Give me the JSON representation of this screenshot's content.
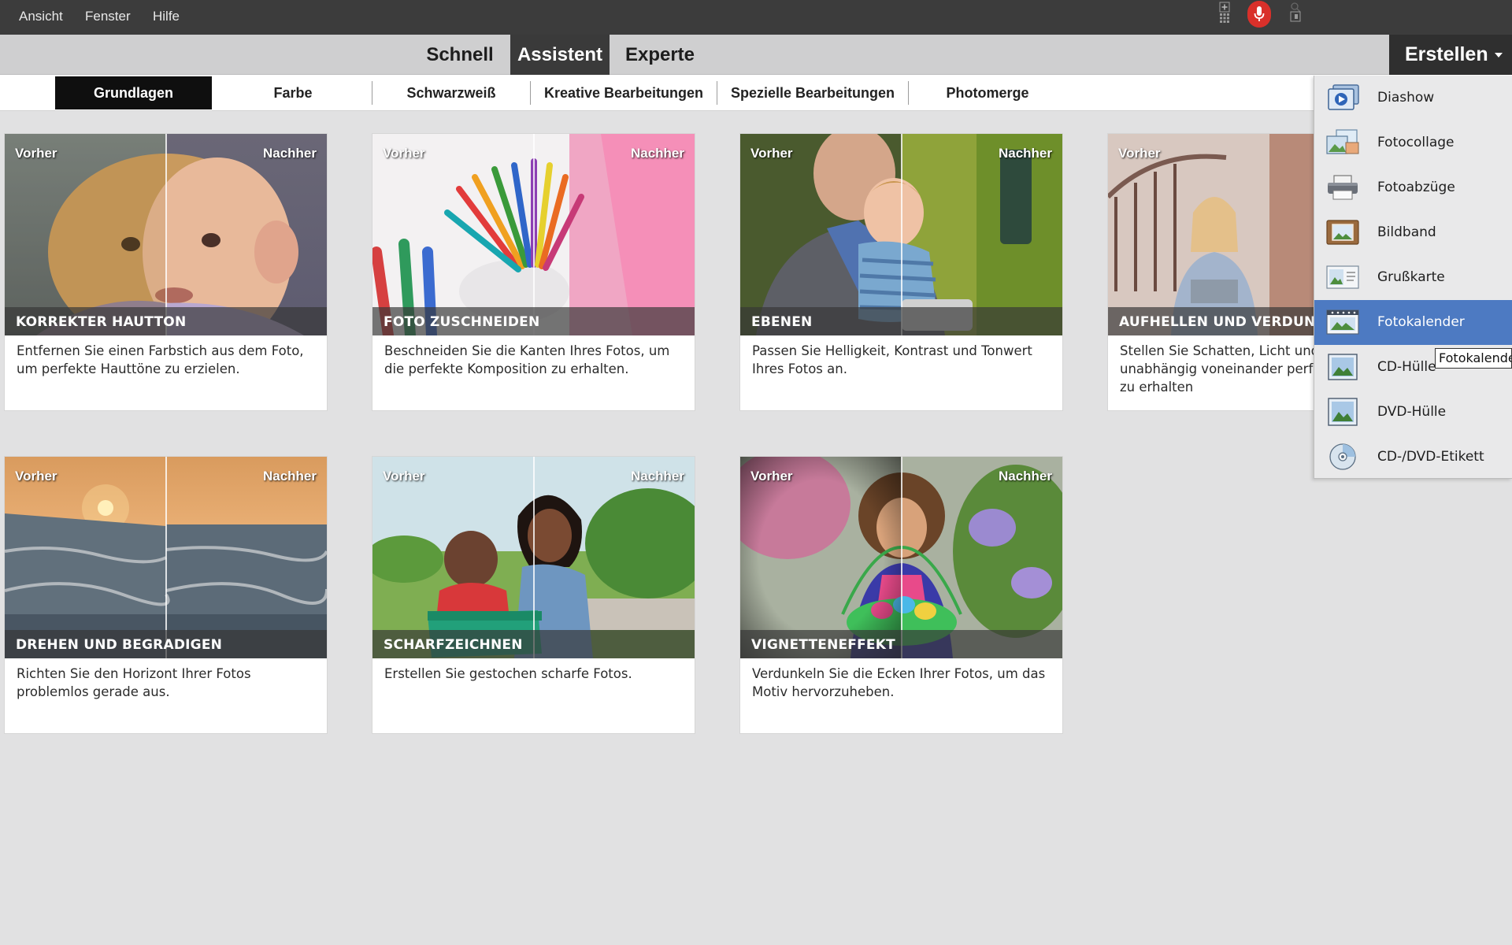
{
  "menu": {
    "items": [
      "Ansicht",
      "Fenster",
      "Hilfe"
    ]
  },
  "modes": {
    "tabs": [
      "Schnell",
      "Assistent",
      "Experte"
    ],
    "active": "Assistent",
    "create_label": "Erstellen"
  },
  "categories": {
    "tabs": [
      "Grundlagen",
      "Farbe",
      "Schwarzweiß",
      "Kreative Bearbeitungen",
      "Spezielle Bearbeitungen",
      "Photomerge"
    ],
    "active": "Grundlagen"
  },
  "cards": [
    {
      "before": "Vorher",
      "after": "Nachher",
      "title": "KORREKTER HAUTTON",
      "desc": "Entfernen Sie einen Farbstich aus dem Foto, um perfekte Hauttöne zu erzielen."
    },
    {
      "before": "Vorher",
      "after": "Nachher",
      "title": "FOTO ZUSCHNEIDEN",
      "desc": "Beschneiden Sie die Kanten Ihres Fotos, um die perfekte Komposition zu erhalten."
    },
    {
      "before": "Vorher",
      "after": "Nachher",
      "title": "EBENEN",
      "desc": "Passen Sie Helligkeit, Kontrast und Tonwert Ihres Fotos an."
    },
    {
      "before": "Vorher",
      "after": "",
      "title": "AUFHELLEN UND VERDUNI",
      "desc": "Stellen Sie Schatten, Licht und Fotos unabhängig voneinander perfekte Belichtung zu erhalten"
    },
    {
      "before": "Vorher",
      "after": "Nachher",
      "title": "DREHEN UND BEGRADIGEN",
      "desc": "Richten Sie den Horizont Ihrer Fotos problemlos gerade aus."
    },
    {
      "before": "Vorher",
      "after": "Nachher",
      "title": "SCHARFZEICHNEN",
      "desc": "Erstellen Sie gestochen scharfe Fotos."
    },
    {
      "before": "Vorher",
      "after": "Nachher",
      "title": "VIGNETTENEFFEKT",
      "desc": "Verdunkeln Sie die Ecken Ihrer Fotos, um das Motiv hervorzuheben."
    }
  ],
  "create_menu": {
    "items": [
      {
        "label": "Diashow",
        "icon": "slideshow-icon"
      },
      {
        "label": "Fotocollage",
        "icon": "photo-collage-icon"
      },
      {
        "label": "Fotoabzüge",
        "icon": "printer-icon"
      },
      {
        "label": "Bildband",
        "icon": "photo-book-icon"
      },
      {
        "label": "Grußkarte",
        "icon": "greeting-card-icon"
      },
      {
        "label": "Fotokalender",
        "icon": "calendar-icon"
      },
      {
        "label": "CD-Hülle",
        "icon": "cd-jacket-icon"
      },
      {
        "label": "DVD-Hülle",
        "icon": "dvd-jacket-icon"
      },
      {
        "label": "CD-/DVD-Etikett",
        "icon": "disc-label-icon"
      }
    ],
    "highlighted": "Fotokalender",
    "tooltip": "Fotokalende"
  },
  "colors": {
    "menubar": "#3c3c3c",
    "modebar": "#cfcfd0",
    "active_tab": "#3a3a3a",
    "category_active": "#0f0f0f",
    "highlight": "#4d7ac2",
    "mic": "#d9302a",
    "background": "#e1e1e2"
  }
}
